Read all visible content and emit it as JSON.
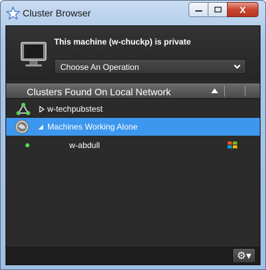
{
  "window": {
    "title": "Cluster Browser",
    "controls": {
      "minimize": "—",
      "maximize": "□",
      "close": "X"
    }
  },
  "machine": {
    "status_text": "This machine (w-chuckp) is private"
  },
  "operation_select": {
    "selected": "Choose An Operation"
  },
  "list": {
    "header": "Clusters Found On Local Network",
    "rows": [
      {
        "label": "w-techpubstest",
        "icon": "cluster-network-icon",
        "expanded": false
      },
      {
        "label": "Machines Working Alone",
        "icon": "globe-icon",
        "expanded": true,
        "selected": true
      },
      {
        "label": "w-abdull",
        "icon": "windows-logo-icon",
        "status": "online"
      }
    ]
  },
  "footer": {
    "gear_label": "⚙▾"
  },
  "colors": {
    "selection": "#3d97ee",
    "panel_bg": "#2b2b2b",
    "status_online": "#57d655"
  }
}
